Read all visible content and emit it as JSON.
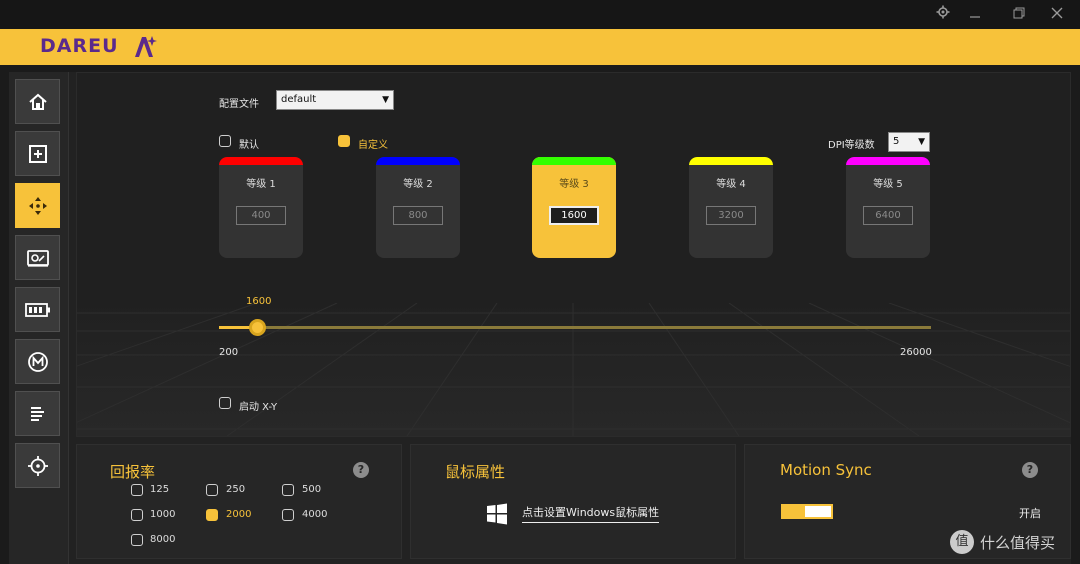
{
  "window": {
    "controls": [
      "gear-icon",
      "minimize-icon",
      "restore-icon",
      "close-icon"
    ]
  },
  "brand": {
    "logo": "DAREU",
    "accent": "#f7c23a",
    "logo_color": "#5b2a8c"
  },
  "sidebar": {
    "items": [
      {
        "name": "home",
        "icon": "home-icon"
      },
      {
        "name": "buttons",
        "icon": "plus-square-icon"
      },
      {
        "name": "dpi",
        "icon": "dpi-arrows-icon",
        "active": true
      },
      {
        "name": "performance",
        "icon": "sensor-icon"
      },
      {
        "name": "battery",
        "icon": "battery-icon"
      },
      {
        "name": "macro",
        "icon": "macro-m-icon"
      },
      {
        "name": "settings",
        "icon": "list-icon"
      },
      {
        "name": "calibration",
        "icon": "crosshair-icon"
      }
    ]
  },
  "profile": {
    "label": "配置文件",
    "value": "default"
  },
  "mode": {
    "default_label": "默认",
    "custom_label": "自定义",
    "custom_checked": true
  },
  "dpi_levels": {
    "label": "DPI等级数",
    "value": "5"
  },
  "levels": [
    {
      "name": "等级",
      "num": "1",
      "value": "400",
      "color": "#ff0000"
    },
    {
      "name": "等级",
      "num": "2",
      "value": "800",
      "color": "#0000ff"
    },
    {
      "name": "等级",
      "num": "3",
      "value": "1600",
      "color": "#33ff00",
      "active": true
    },
    {
      "name": "等级",
      "num": "4",
      "value": "3200",
      "color": "#ffff00"
    },
    {
      "name": "等级",
      "num": "5",
      "value": "6400",
      "color": "#ff00ff"
    }
  ],
  "slider": {
    "current": "1600",
    "min": "200",
    "max": "26000",
    "fraction": 0.054
  },
  "xy": {
    "label": "启动 X-Y",
    "checked": false
  },
  "polling": {
    "title": "回报率",
    "rates": [
      {
        "label": "125",
        "checked": false
      },
      {
        "label": "250",
        "checked": false
      },
      {
        "label": "500",
        "checked": false
      },
      {
        "label": "1000",
        "checked": false
      },
      {
        "label": "2000",
        "checked": true
      },
      {
        "label": "4000",
        "checked": false
      },
      {
        "label": "8000",
        "checked": false
      }
    ]
  },
  "mouse_props": {
    "title": "鼠标属性",
    "link": "点击设置Windows鼠标属性"
  },
  "motion_sync": {
    "title": "Motion Sync",
    "state": "开启",
    "on": true
  },
  "watermark": "值 什么值得买"
}
